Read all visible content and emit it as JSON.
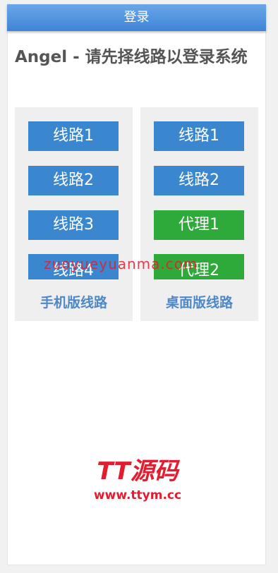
{
  "header": {
    "login_label": "登录"
  },
  "title": "Angel - 请先择线路以登录系统",
  "mobile": {
    "label": "手机版线路",
    "buttons": [
      "线路1",
      "线路2",
      "线路3",
      "线路4"
    ]
  },
  "desktop": {
    "label": "桌面版线路",
    "buttons": [
      "线路1",
      "线路2",
      "代理1",
      "代理2"
    ]
  },
  "watermark": "zuoyueyuanma.com",
  "logo": {
    "brand": "TT源码",
    "url": "www.ttym.cc"
  },
  "colors": {
    "header": "#3f84d8",
    "button_blue": "#3b87cf",
    "button_green": "#2eaa3a",
    "label": "#4f88c6",
    "watermark": "#e31d30"
  }
}
